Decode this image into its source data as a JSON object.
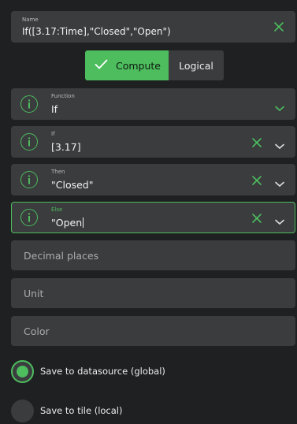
{
  "name_field": {
    "label": "Name",
    "value": "If([3.17:Time],\"Closed\",\"Open\")",
    "clear_icon": "close-icon"
  },
  "mode_toggle": {
    "compute_label": "Compute",
    "logical_label": "Logical",
    "selected": "Compute",
    "compute_icon": "check-icon"
  },
  "selects": [
    {
      "label": "Function",
      "value": "If",
      "info_icon": "info-icon",
      "chevron_icon": "chevron-down-icon"
    },
    {
      "label": "If",
      "value": "[3.17]",
      "info_icon": "info-icon",
      "clear_icon": "close-icon",
      "chevron_icon": "chevron-down-icon"
    },
    {
      "label": "Then",
      "value": "\"Closed\"",
      "info_icon": "info-icon",
      "clear_icon": "close-icon",
      "chevron_icon": "chevron-down-icon"
    },
    {
      "label": "Else",
      "value": "\"Open",
      "info_icon": "info-icon",
      "clear_icon": "close-icon",
      "chevron_icon": "chevron-down-icon",
      "focused": true
    }
  ],
  "inputs": {
    "decimal_places_placeholder": "Decimal places",
    "unit_placeholder": "Unit",
    "color_placeholder": "Color"
  },
  "save_options": {
    "global_label": "Save to datasource (global)",
    "local_label": "Save to tile (local)",
    "selected": "global"
  },
  "colors": {
    "accent": "#4dbd5e",
    "background": "#1f2021",
    "field": "#3a3c3e"
  }
}
